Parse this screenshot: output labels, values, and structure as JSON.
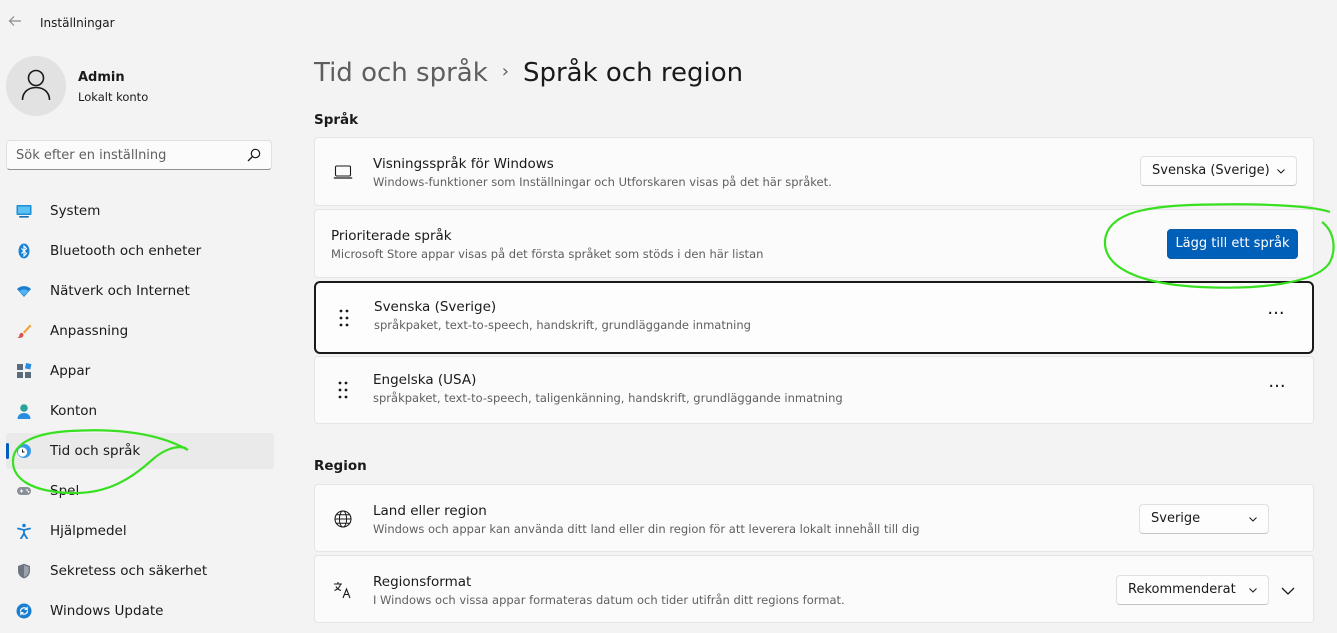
{
  "window": {
    "title": "Inställningar"
  },
  "profile": {
    "name": "Admin",
    "account_type": "Lokalt konto"
  },
  "search": {
    "placeholder": "Sök efter en inställning"
  },
  "sidebar": {
    "items": [
      {
        "label": "System",
        "icon": "monitor-icon"
      },
      {
        "label": "Bluetooth och enheter",
        "icon": "bluetooth-icon"
      },
      {
        "label": "Nätverk och Internet",
        "icon": "wifi-icon"
      },
      {
        "label": "Anpassning",
        "icon": "brush-icon"
      },
      {
        "label": "Appar",
        "icon": "apps-icon"
      },
      {
        "label": "Konton",
        "icon": "person-icon"
      },
      {
        "label": "Tid och språk",
        "icon": "globe-clock-icon",
        "selected": true
      },
      {
        "label": "Spel",
        "icon": "gamepad-icon"
      },
      {
        "label": "Hjälpmedel",
        "icon": "accessibility-icon"
      },
      {
        "label": "Sekretess och säkerhet",
        "icon": "shield-icon"
      },
      {
        "label": "Windows Update",
        "icon": "update-icon"
      }
    ]
  },
  "breadcrumb": {
    "parent": "Tid och språk",
    "separator": "›",
    "current": "Språk och region"
  },
  "language_section": {
    "title": "Språk",
    "display_language": {
      "title": "Visningsspråk för Windows",
      "description": "Windows-funktioner som Inställningar och Utforskaren visas på det här språket.",
      "value": "Svenska (Sverige)"
    },
    "preferred": {
      "title": "Prioriterade språk",
      "description": "Microsoft Store appar visas på det första språket som stöds i den här listan",
      "add_button": "Lägg till ett språk"
    },
    "languages": [
      {
        "name": "Svenska (Sverige)",
        "features": "språkpaket, text-to-speech, handskrift, grundläggande inmatning",
        "more": "···"
      },
      {
        "name": "Engelska (USA)",
        "features": "språkpaket, text-to-speech, taligenkänning, handskrift, grundläggande inmatning",
        "more": "···"
      }
    ]
  },
  "region_section": {
    "title": "Region",
    "country": {
      "title": "Land eller region",
      "description": "Windows och appar kan använda ditt land eller din region för att leverera lokalt innehåll till dig",
      "value": "Sverige"
    },
    "format": {
      "title": "Regionsformat",
      "description": "I Windows och vissa appar formateras datum och tider utifrån ditt regions format.",
      "value": "Rekommenderat"
    }
  },
  "colors": {
    "accent": "#005fb8",
    "annotation": "#39e021",
    "background": "#f3f3f3"
  }
}
